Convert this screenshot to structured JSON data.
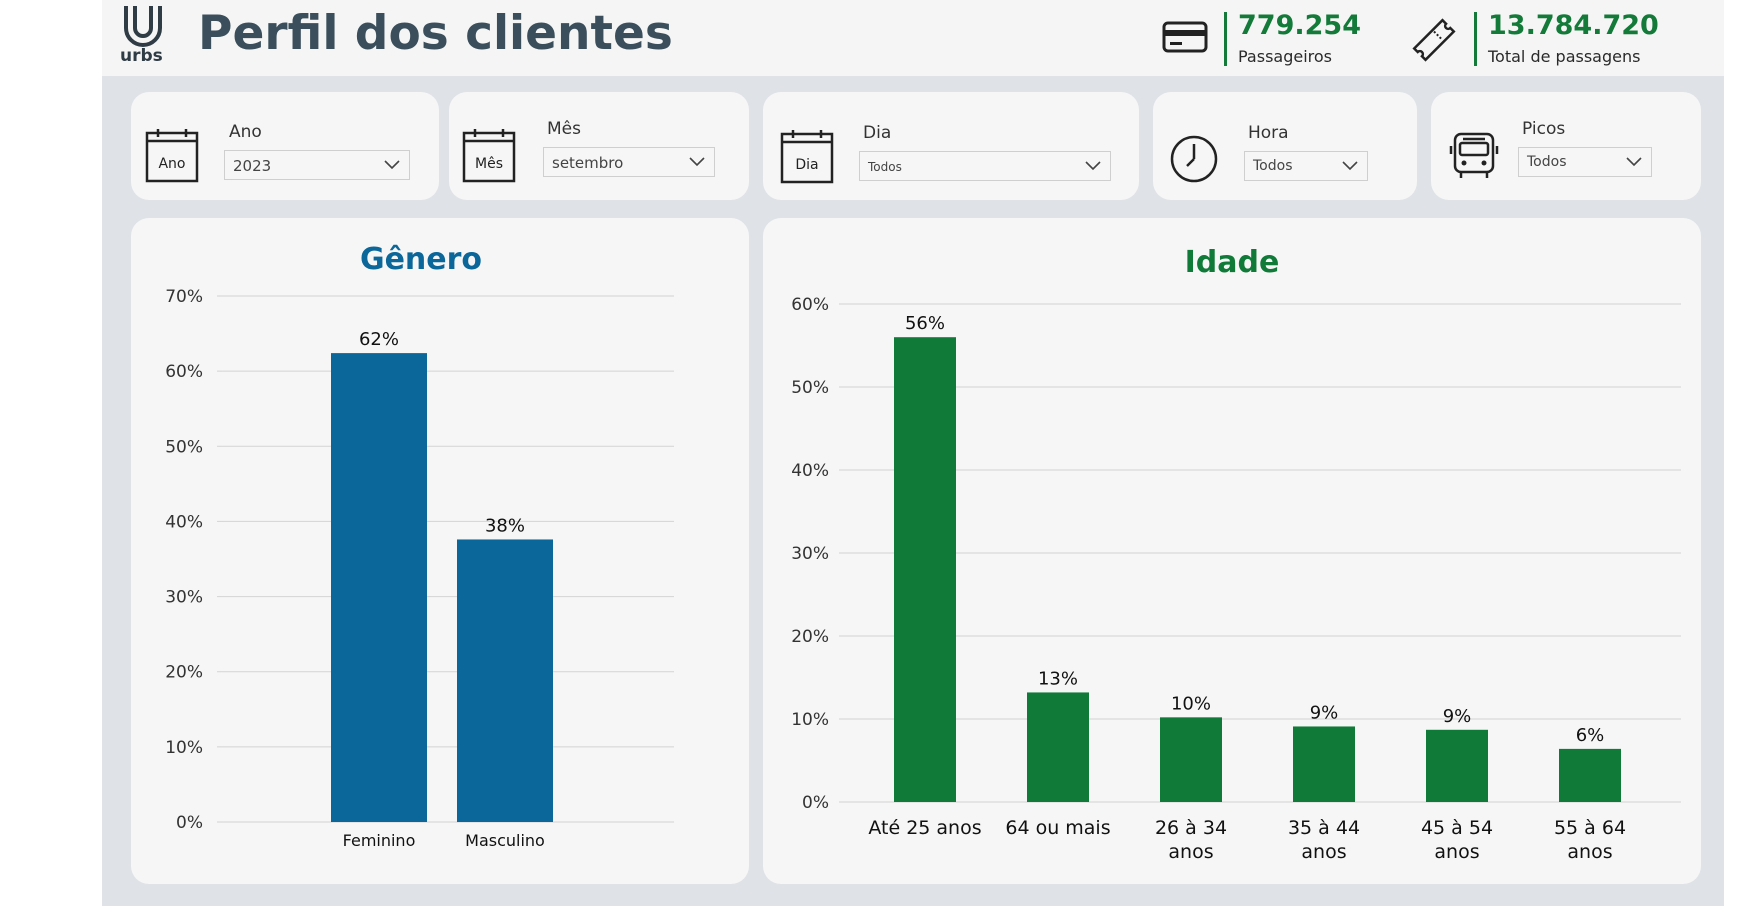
{
  "header": {
    "logo_text": "urbs",
    "title": "Perfil dos clientes",
    "kpis": [
      {
        "icon": "credit-card-icon",
        "value": "779.254",
        "label": "Passageiros"
      },
      {
        "icon": "ticket-icon",
        "value": "13.784.720",
        "label": "Total de passagens"
      }
    ]
  },
  "filters": [
    {
      "icon": "calendar-icon",
      "icon_text": "Ano",
      "label": "Ano",
      "value": "2023"
    },
    {
      "icon": "calendar-icon",
      "icon_text": "Mês",
      "label": "Mês",
      "value": "setembro"
    },
    {
      "icon": "calendar-icon",
      "icon_text": "Dia",
      "label": "Dia",
      "value": "Todos"
    },
    {
      "icon": "clock-icon",
      "label": "Hora",
      "value": "Todos"
    },
    {
      "icon": "bus-icon",
      "label": "Picos",
      "value": "Todos"
    }
  ],
  "colors": {
    "genero": "#0b6799",
    "idade": "#107a38",
    "header_title": "#3a4f5b"
  },
  "chart_data": [
    {
      "type": "bar",
      "title": "Gênero",
      "categories": [
        "Feminino",
        "Masculino"
      ],
      "values": [
        62.4,
        37.6
      ],
      "data_labels": [
        "62%",
        "38%"
      ],
      "yticks": [
        "0%",
        "10%",
        "20%",
        "30%",
        "40%",
        "50%",
        "60%",
        "70%"
      ],
      "ylim": [
        0,
        70
      ],
      "grid": true
    },
    {
      "type": "bar",
      "title": "Idade",
      "categories": [
        [
          "Até 25 anos"
        ],
        [
          "64 ou mais"
        ],
        [
          "26 à 34",
          "anos"
        ],
        [
          "35 à 44",
          "anos"
        ],
        [
          "45 à 54",
          "anos"
        ],
        [
          "55 à 64",
          "anos"
        ]
      ],
      "values": [
        56.0,
        13.2,
        10.2,
        9.1,
        8.7,
        6.4
      ],
      "data_labels": [
        "56%",
        "13%",
        "10%",
        "9%",
        "9%",
        "6%"
      ],
      "yticks": [
        "0%",
        "10%",
        "20%",
        "30%",
        "40%",
        "50%",
        "60%"
      ],
      "ylim": [
        0,
        60
      ],
      "grid": true
    }
  ]
}
